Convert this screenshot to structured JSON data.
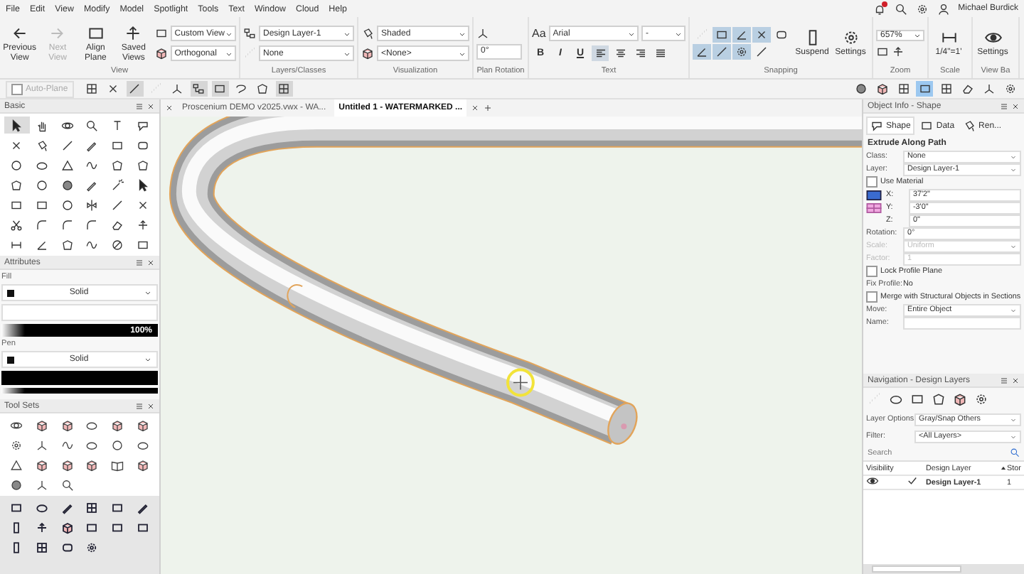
{
  "menu": [
    "File",
    "Edit",
    "View",
    "Modify",
    "Model",
    "Spotlight",
    "Tools",
    "Text",
    "Window",
    "Cloud",
    "Help"
  ],
  "account": {
    "alert": true,
    "user": "Michael Burdick"
  },
  "ribbon": [
    {
      "kind": "view",
      "label": "View",
      "buttons": [
        {
          "label": "Previous View",
          "disabled": false
        },
        {
          "label": "Next View",
          "disabled": true
        },
        {
          "label": "Align Plane",
          "disabled": false
        },
        {
          "label": "Saved Views",
          "disabled": false
        }
      ],
      "dropdowns": [
        "Custom View",
        "Orthogonal"
      ]
    },
    {
      "kind": "layers",
      "label": "Layers/Classes",
      "dropdowns": [
        "Design Layer-1",
        "None"
      ]
    },
    {
      "kind": "visualization",
      "label": "Visualization",
      "dropdowns": [
        "Shaded",
        "<None>"
      ]
    },
    {
      "kind": "rotation",
      "label": "Plan Rotation",
      "value": "0°"
    },
    {
      "kind": "text",
      "label": "Text",
      "font_icon": "Aa",
      "font": "Arial",
      "size": "-",
      "styles": [
        "B",
        "I",
        "U"
      ],
      "align": [
        {
          "selected": true
        },
        {
          "selected": false
        },
        {
          "selected": false
        },
        {
          "selected": false
        }
      ]
    },
    {
      "kind": "snapping",
      "label": "Snapping",
      "toggles": [
        {
          "selected": false
        },
        {
          "selected": true
        },
        {
          "selected": true
        },
        {
          "selected": true
        },
        {
          "selected": false
        },
        {
          "selected": true
        },
        {
          "selected": true
        },
        {
          "selected": true
        },
        {
          "selected": false
        }
      ],
      "buttons": [
        "Suspend",
        "Settings"
      ]
    },
    {
      "kind": "zoom",
      "label": "Zoom",
      "value": "657%"
    },
    {
      "kind": "scale",
      "label": "Scale",
      "value": "1/4\"=1'"
    },
    {
      "kind": "viewbar",
      "label": "View Ba",
      "button": "Settings"
    }
  ],
  "mode_bar": {
    "auto_plane": {
      "label": "Auto-Plane",
      "checked": false,
      "disabled": true
    },
    "modes": [
      {
        "selected": false
      },
      {
        "selected": false
      },
      {
        "selected": true
      },
      {
        "selected": false
      },
      {
        "selected": false
      },
      {
        "selected": true
      },
      {
        "selected": true
      },
      {
        "selected": false
      },
      {
        "selected": false
      },
      {
        "selected": true
      }
    ],
    "view_tools": [
      {
        "selected": false
      },
      {
        "selected": false
      },
      {
        "selected": false
      },
      {
        "selected": true
      },
      {
        "selected": false
      },
      {
        "selected": false
      },
      {
        "selected": false
      },
      {
        "selected": false
      }
    ]
  },
  "doc_tabs": [
    {
      "label": "Proscenium DEMO v2025.vwx - WA...",
      "selected": false
    },
    {
      "label": "Untitled 1 - WATERMARKED ...",
      "selected": true
    }
  ],
  "basic": {
    "title": "Basic"
  },
  "attributes": {
    "title": "Attributes",
    "fill_label": "Fill",
    "fill_style": "Solid",
    "opacity": "100%",
    "fill_slider": {
      "level": 1
    },
    "pen_slider": {
      "level": 1
    },
    "pen_label": "Pen",
    "pen_style": "Solid"
  },
  "tool_sets": {
    "title": "Tool Sets"
  },
  "object_info": {
    "title": "Object Info - Shape",
    "tabs": [
      {
        "label": "Shape",
        "selected": true
      },
      {
        "label": "Data",
        "selected": false
      },
      {
        "label": "Ren...",
        "selected": false
      }
    ],
    "object_type": "Extrude Along Path",
    "fields": [
      {
        "kind": "select",
        "label": "Class:",
        "value": "None",
        "disabled": false
      },
      {
        "kind": "select",
        "label": "Layer:",
        "value": "Design Layer-1",
        "disabled": false
      },
      {
        "kind": "check",
        "label": "Use Material",
        "checked": false,
        "disabled": false
      },
      {
        "kind": "coord",
        "label": "X:",
        "value": "37'2\"",
        "disabled": false
      },
      {
        "kind": "coord",
        "label": "Y:",
        "value": "-3'0\"",
        "disabled": false
      },
      {
        "kind": "coord",
        "label": "Z:",
        "value": "0\"",
        "disabled": false
      },
      {
        "kind": "text",
        "label": "Rotation:",
        "value": "0°",
        "disabled": false
      },
      {
        "kind": "select",
        "label": "Scale:",
        "value": "Uniform",
        "disabled": true
      },
      {
        "kind": "text",
        "label": "Factor:",
        "value": "1",
        "disabled": true
      },
      {
        "kind": "check",
        "label": "Lock Profile Plane",
        "checked": false,
        "disabled": false
      },
      {
        "kind": "static",
        "label": "Fix Profile:",
        "value": "No",
        "disabled": false
      },
      {
        "kind": "check",
        "label": "Merge with Structural Objects in Sections",
        "checked": false,
        "disabled": false
      },
      {
        "kind": "select",
        "label": "Move:",
        "value": "Entire Object",
        "disabled": false
      },
      {
        "kind": "text",
        "label": "Name:",
        "disabled": false
      }
    ]
  },
  "navigation": {
    "title": "Navigation - Design Layers",
    "layer_options_label": "Layer Options:",
    "layer_options": "Gray/Snap Others",
    "filter_label": "Filter:",
    "filter": "<All Layers>",
    "search_placeholder": "Search",
    "columns": [
      "Visibility",
      "Design Layer",
      "Stor"
    ],
    "rows": [
      {
        "visible": true,
        "active": true,
        "name": "Design Layer-1",
        "number": "1"
      }
    ]
  }
}
